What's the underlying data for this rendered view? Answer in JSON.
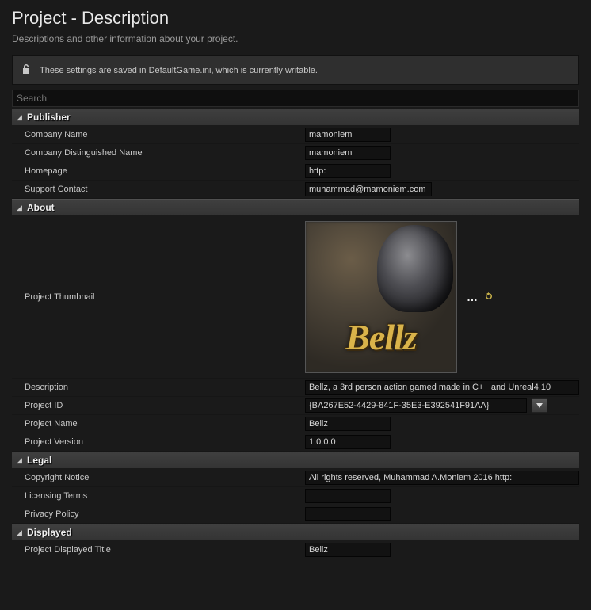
{
  "header": {
    "title": "Project - Description",
    "subtitle": "Descriptions and other information about your project."
  },
  "banner": {
    "text": "These settings are saved in DefaultGame.ini, which is currently writable."
  },
  "search": {
    "placeholder": "Search"
  },
  "sections": {
    "publisher": {
      "title": "Publisher",
      "company_name": {
        "label": "Company Name",
        "value": "mamoniem"
      },
      "company_distinguished_name": {
        "label": "Company Distinguished Name",
        "value": "mamoniem"
      },
      "homepage": {
        "label": "Homepage",
        "value": "http:"
      },
      "support_contact": {
        "label": "Support Contact",
        "value": "muhammad@mamoniem.com"
      }
    },
    "about": {
      "title": "About",
      "project_thumbnail": {
        "label": "Project Thumbnail",
        "logo_text": "Bellz"
      },
      "description": {
        "label": "Description",
        "value": "Bellz, a 3rd person action gamed made in C++ and Unreal4.10"
      },
      "project_id": {
        "label": "Project ID",
        "value": "{BA267E52-4429-841F-35E3-E392541F91AA}"
      },
      "project_name": {
        "label": "Project Name",
        "value": "Bellz"
      },
      "project_version": {
        "label": "Project Version",
        "value": "1.0.0.0"
      }
    },
    "legal": {
      "title": "Legal",
      "copyright_notice": {
        "label": "Copyright Notice",
        "value": "All rights reserved, Muhammad A.Moniem 2016 http:"
      },
      "licensing_terms": {
        "label": "Licensing Terms",
        "value": ""
      },
      "privacy_policy": {
        "label": "Privacy Policy",
        "value": ""
      }
    },
    "displayed": {
      "title": "Displayed",
      "project_displayed_title": {
        "label": "Project Displayed Title",
        "value": "Bellz"
      }
    }
  }
}
